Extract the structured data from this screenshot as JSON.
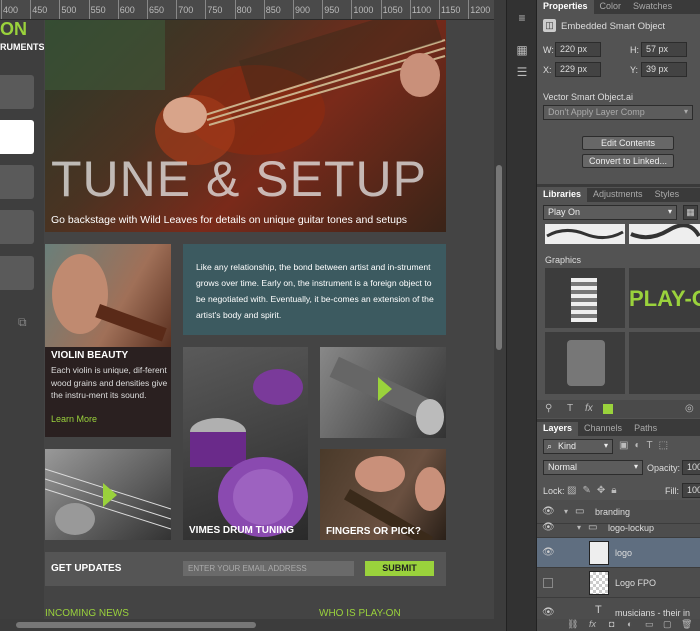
{
  "ruler": {
    "ticks": [
      "400",
      "450",
      "500",
      "550",
      "600",
      "650",
      "700",
      "750",
      "800",
      "850",
      "900",
      "950",
      "1000",
      "1050",
      "1100",
      "1150",
      "1200"
    ]
  },
  "site": {
    "logo_text": "RUMENTS",
    "logo_top": "ON",
    "hero": {
      "title": "TUNE & SETUP",
      "subtitle": "Go backstage with Wild Leaves for details on unique guitar tones and setups"
    },
    "quote": "Like any relationship, the bond between artist and in-strument grows over time. Early on, the instrument is a foreign object to be negotiated with. Eventually, it be-comes an extension of the artist's body and spirit.",
    "violin": {
      "title": "VIOLIN BEAUTY",
      "body": "Each violin is unique, dif-ferent wood grains and densities give the instru-ment its sound.",
      "link": "Learn More"
    },
    "drum_caption": "VIMES DRUM TUNING",
    "pick_caption": "FINGERS OR PICK?",
    "updates": {
      "label": "GET UPDATES",
      "placeholder": "ENTER YOUR EMAIL ADDRESS",
      "submit": "SUBMIT"
    },
    "footer": {
      "left": "INCOMING NEWS",
      "right": "WHO IS PLAY-ON"
    },
    "accent": "#9ad23c"
  },
  "panels": {
    "props_tabs": [
      "Properties",
      "Color",
      "Swatches"
    ],
    "props_title": "Embedded Smart Object",
    "w_label": "W:",
    "w_value": "220 px",
    "h_label": "H:",
    "h_value": "57 px",
    "x_label": "X:",
    "x_value": "229 px",
    "y_label": "Y:",
    "y_value": "39 px",
    "source_file": "Vector Smart Object.ai",
    "layer_comp": "Don't Apply Layer Comp",
    "edit_contents": "Edit Contents",
    "convert_linked": "Convert to Linked...",
    "lib_tabs": [
      "Libraries",
      "Adjustments",
      "Styles"
    ],
    "library_select": "Play On",
    "graphics_label": "Graphics",
    "graphic_text": "PLAY-O",
    "layers_tabs": [
      "Layers",
      "Channels",
      "Paths"
    ],
    "kind_filter": "Kind",
    "blend_mode": "Normal",
    "opacity_label": "Opacity:",
    "opacity_value": "100",
    "lock_label": "Lock:",
    "fill_label": "Fill:",
    "fill_value": "100",
    "layers": [
      {
        "name": "branding"
      },
      {
        "name": "logo-lockup"
      },
      {
        "name": "logo"
      },
      {
        "name": "Logo FPO"
      },
      {
        "name": "musicians - their in"
      }
    ]
  }
}
